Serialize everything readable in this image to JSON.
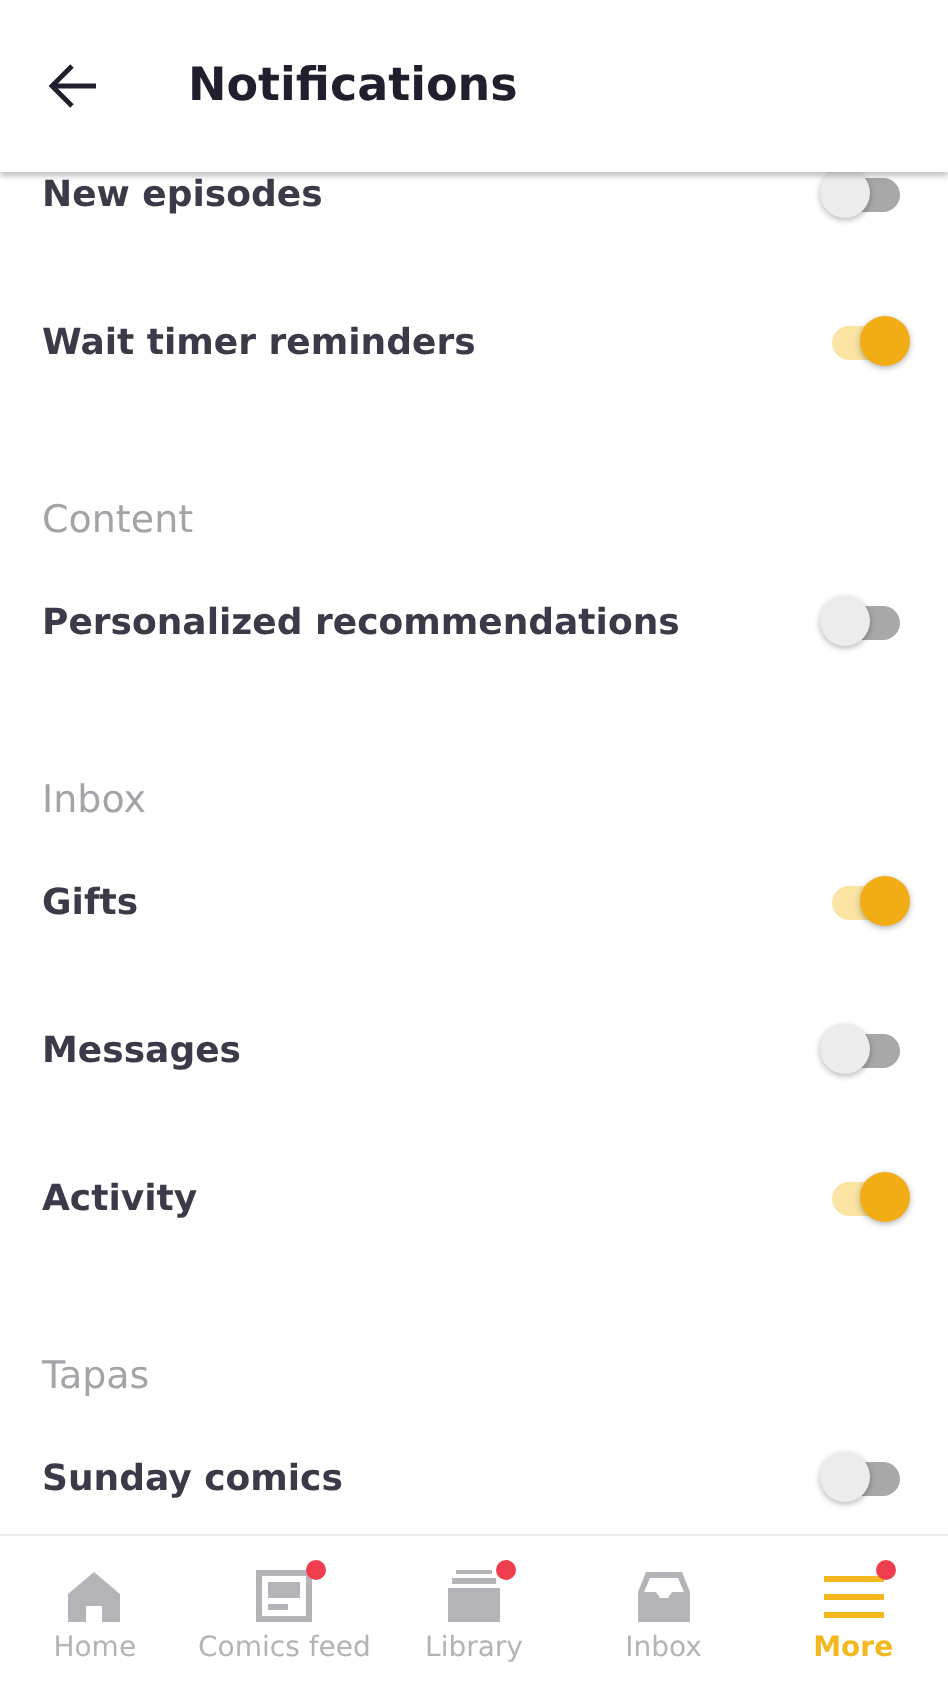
{
  "header": {
    "title": "Notifications"
  },
  "sections": [
    {
      "items": [
        {
          "label": "New episodes",
          "on": false
        },
        {
          "label": "Wait timer reminders",
          "on": true
        }
      ]
    },
    {
      "title": "Content",
      "items": [
        {
          "label": "Personalized recommendations",
          "on": false
        }
      ]
    },
    {
      "title": "Inbox",
      "items": [
        {
          "label": "Gifts",
          "on": true
        },
        {
          "label": "Messages",
          "on": false
        },
        {
          "label": "Activity",
          "on": true
        }
      ]
    },
    {
      "title": "Tapas",
      "items": [
        {
          "label": "Sunday comics",
          "on": false
        }
      ]
    }
  ],
  "nav": [
    {
      "kind": "home",
      "label": "Home",
      "selected": false,
      "badge": false
    },
    {
      "kind": "feed",
      "label": "Comics feed",
      "selected": false,
      "badge": true
    },
    {
      "kind": "library",
      "label": "Library",
      "selected": false,
      "badge": true
    },
    {
      "kind": "inbox",
      "label": "Inbox",
      "selected": false,
      "badge": false
    },
    {
      "kind": "more",
      "label": "More",
      "selected": true,
      "badge": true
    }
  ]
}
